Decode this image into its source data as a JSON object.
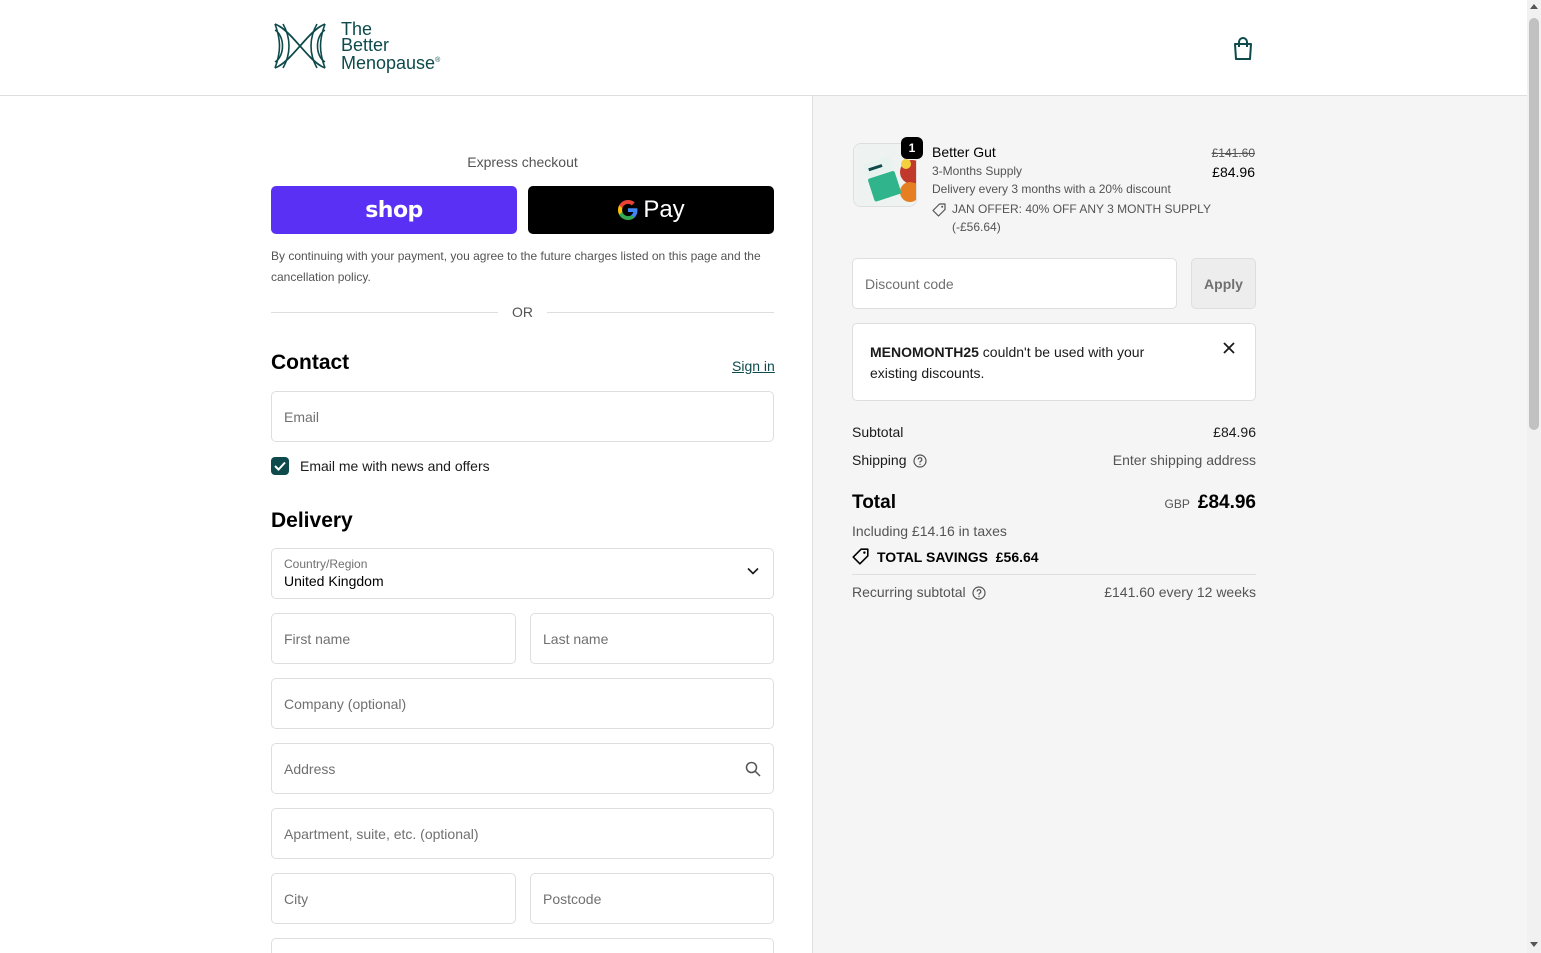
{
  "brand": {
    "logo_line1": "The",
    "logo_line2": "Better",
    "logo_line3": "Menopause",
    "logo_reg": "®",
    "accent": "#0e4a4c"
  },
  "header": {
    "cart_icon": "shopping-bag-icon"
  },
  "express": {
    "label": "Express checkout",
    "shop_label": "shop",
    "gpay_label": "Pay",
    "shop_color": "#5a31f4",
    "terms": "By continuing with your payment, you agree to the future charges listed on this page and the cancellation policy.",
    "or_label": "OR"
  },
  "contact": {
    "title": "Contact",
    "signin_label": "Sign in",
    "email_placeholder": "Email",
    "newsletter_label": "Email me with news and offers",
    "newsletter_checked": true
  },
  "delivery": {
    "title": "Delivery",
    "country_label": "Country/Region",
    "country_value": "United Kingdom",
    "first_name_placeholder": "First name",
    "last_name_placeholder": "Last name",
    "company_placeholder": "Company (optional)",
    "address_placeholder": "Address",
    "apartment_placeholder": "Apartment, suite, etc. (optional)",
    "city_placeholder": "City",
    "postcode_placeholder": "Postcode"
  },
  "summary": {
    "product": {
      "name": "Better Gut",
      "quantity": "1",
      "variant": "3-Months Supply",
      "delivery": "Delivery every 3 months with a 20% discount",
      "offer": "JAN OFFER: 40% OFF ANY 3 MONTH SUPPLY (-£56.64)",
      "price_original": "£141.60",
      "price_current": "£84.96"
    },
    "discount_placeholder": "Discount code",
    "apply_label": "Apply",
    "error_code": "MENOMONTH25",
    "error_message": " couldn't be used with your existing discounts.",
    "subtotal_label": "Subtotal",
    "subtotal_value": "£84.96",
    "shipping_label": "Shipping",
    "shipping_value": "Enter shipping address",
    "total_label": "Total",
    "total_currency": "GBP",
    "total_value": "£84.96",
    "taxes_note": "Including £14.16 in taxes",
    "savings_label": "TOTAL SAVINGS",
    "savings_value": "£56.64",
    "recurring_label": "Recurring subtotal",
    "recurring_value": "£141.60 every 12 weeks"
  }
}
